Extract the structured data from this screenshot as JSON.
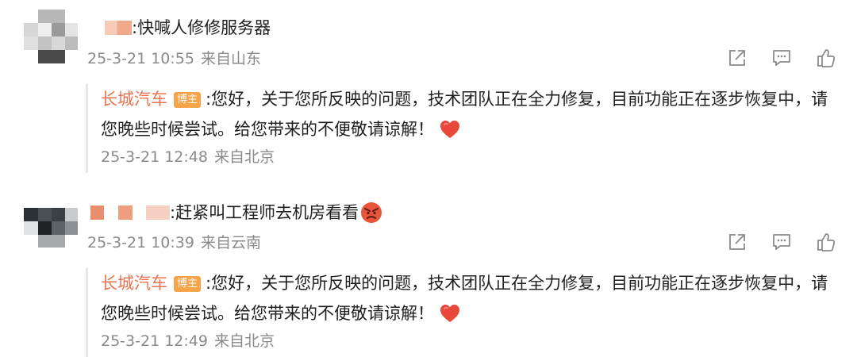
{
  "comments": [
    {
      "text": ":快喊人修修服务器",
      "date": "25-3-21 10:55",
      "location": "来自山东",
      "reply": {
        "author": "长城汽车",
        "badge": "博主",
        "text": ":您好，关于您所反映的问题，技术团队正在全力修复，目前功能正在逐步恢复中，请您晚些时候尝试。给您带来的不便敬请谅解！",
        "date": "25-3-21 12:48",
        "location": "来自北京"
      }
    },
    {
      "text": ":赶紧叫工程师去机房看看",
      "date": "25-3-21 10:39",
      "location": "来自云南",
      "reply": {
        "author": "长城汽车",
        "badge": "博主",
        "text": ":您好，关于您所反映的问题，技术团队正在全力修复，目前功能正在逐步恢复中，请您晚些时候尝试。给您带来的不便敬请谅解！",
        "date": "25-3-21 12:49",
        "location": "来自北京"
      }
    }
  ],
  "icons": {
    "share": "share-icon",
    "comment": "comment-icon",
    "like": "like-icon",
    "heart": "heart-emoji",
    "angry": "angry-emoji"
  },
  "colors": {
    "reply_author": "#eb7350",
    "badge_bg": "#f6a44a",
    "meta_text": "#8a8a8a",
    "heart": "#e8483b"
  }
}
